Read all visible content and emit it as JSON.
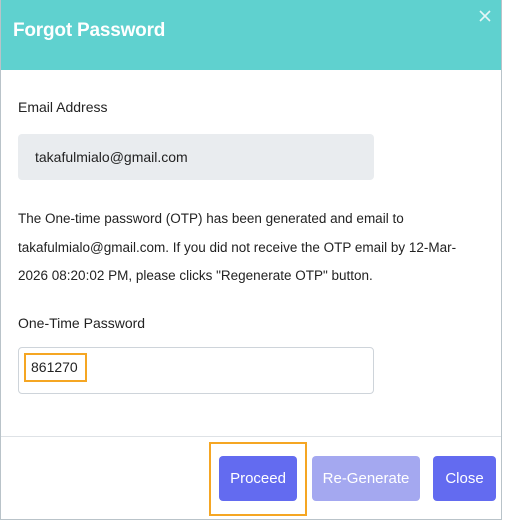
{
  "modal": {
    "title": "Forgot Password",
    "close_icon": "close-icon"
  },
  "email": {
    "label": "Email Address",
    "value": "takafulmialo@gmail.com"
  },
  "message": {
    "line1": "The One-time password (OTP) has been generated and email to",
    "line2": "takafulmialo@gmail.com. If you did not receive the OTP email by 12-Mar-",
    "line3": "2026 08:20:02 PM, please clicks \"Regenerate OTP\" button."
  },
  "otp": {
    "label": "One-Time Password",
    "value": "861270"
  },
  "footer": {
    "proceed_label": "Proceed",
    "regenerate_label": "Re-Generate",
    "close_label": "Close"
  },
  "colors": {
    "header": "#5fd1cf",
    "primary_button": "#636bf0",
    "disabled_button": "#a4a8f0",
    "highlight": "#f5a623"
  }
}
